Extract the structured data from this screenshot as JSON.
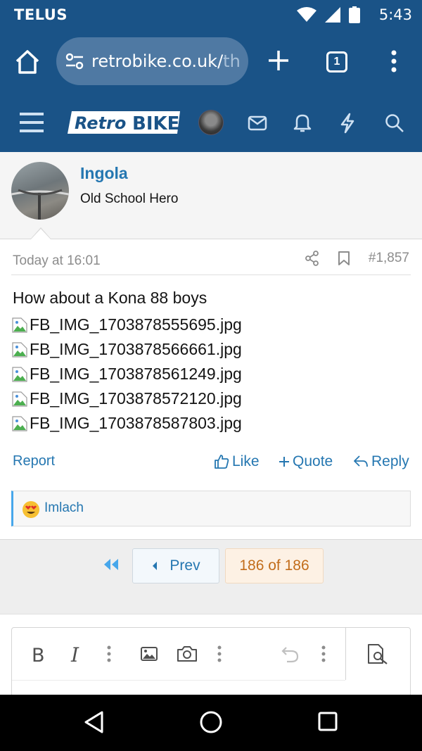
{
  "status_bar": {
    "carrier": "TELUS",
    "time": "5:43"
  },
  "browser": {
    "url_main": "retrobike.co.uk/",
    "url_faded": "th",
    "tab_count": "1"
  },
  "site": {
    "logo_text_retro": "Retro",
    "logo_text_bike": "BIKE"
  },
  "post": {
    "author": "Ingola",
    "author_title": "Old School Hero",
    "time": "Today at 16:01",
    "number": "#1,857",
    "body": "How about a Kona 88 boys",
    "attachments": [
      "FB_IMG_1703878555695.jpg",
      "FB_IMG_1703878566661.jpg",
      "FB_IMG_1703878561249.jpg",
      "FB_IMG_1703878572120.jpg",
      "FB_IMG_1703878587803.jpg"
    ],
    "actions": {
      "report": "Report",
      "like": "Like",
      "quote": "Quote",
      "reply": "Reply"
    },
    "reactions": {
      "users": "Imlach"
    }
  },
  "pager": {
    "prev": "Prev",
    "info": "186 of 186"
  },
  "colors": {
    "brand": "#1a5387",
    "link": "#2577b1",
    "pager_current": "#c26d1b"
  }
}
